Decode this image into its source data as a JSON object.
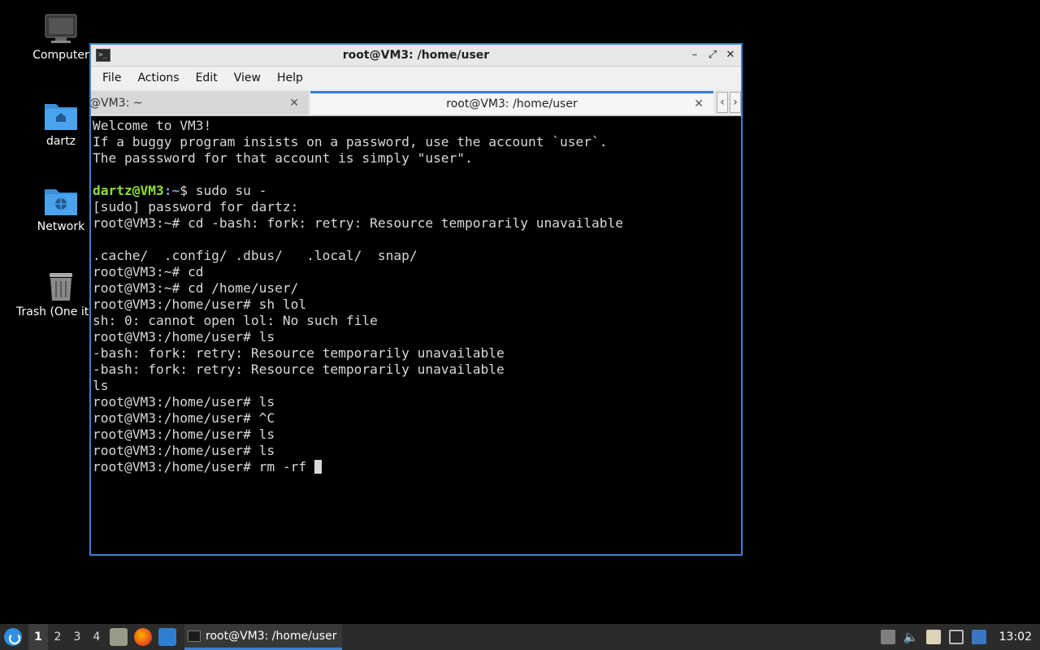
{
  "desktop": {
    "icons": [
      {
        "label": "Computer",
        "icon": "computer-icon"
      },
      {
        "label": "dartz",
        "icon": "home-folder-icon"
      },
      {
        "label": "Network",
        "icon": "network-folder-icon"
      },
      {
        "label": "Trash (One item)",
        "icon": "trash-icon"
      }
    ]
  },
  "window": {
    "title": "root@VM3: /home/user",
    "controls": {
      "minimize": "–",
      "maximize": "⤢",
      "close": "✕"
    },
    "menu": [
      "File",
      "Actions",
      "Edit",
      "View",
      "Help"
    ],
    "tabs": [
      {
        "label": "@VM3: ~",
        "active": false
      },
      {
        "label": "root@VM3: /home/user",
        "active": true
      }
    ],
    "tab_close": "✕",
    "tab_scroll_left": "‹",
    "tab_scroll_right": "›"
  },
  "terminal": {
    "lines": [
      "Welcome to VM3!",
      "If a buggy program insists on a password, use the account `user`.",
      "The passsword for that account is simply \"user\".",
      "",
      "$ sudo su -",
      "[sudo] password for dartz:",
      "root@VM3:~# cd -bash: fork: retry: Resource temporarily unavailable",
      "",
      ".cache/  .config/ .dbus/   .local/  snap/",
      "root@VM3:~# cd",
      "root@VM3:~# cd /home/user/",
      "root@VM3:/home/user# sh lol",
      "sh: 0: cannot open lol: No such file",
      "root@VM3:/home/user# ls",
      "-bash: fork: retry: Resource temporarily unavailable",
      "-bash: fork: retry: Resource temporarily unavailable",
      "ls",
      "root@VM3:/home/user# ls",
      "root@VM3:/home/user# ^C",
      "root@VM3:/home/user# ls",
      "root@VM3:/home/user# ls",
      "root@VM3:/home/user# rm -rf "
    ],
    "prompt_user_host": "dartz@VM3",
    "prompt_colon": ":",
    "prompt_path": "~"
  },
  "taskbar": {
    "workspaces": [
      "1",
      "2",
      "3",
      "4"
    ],
    "active_workspace": "1",
    "task_label": "root@VM3: /home/user",
    "clock": "13:02"
  }
}
